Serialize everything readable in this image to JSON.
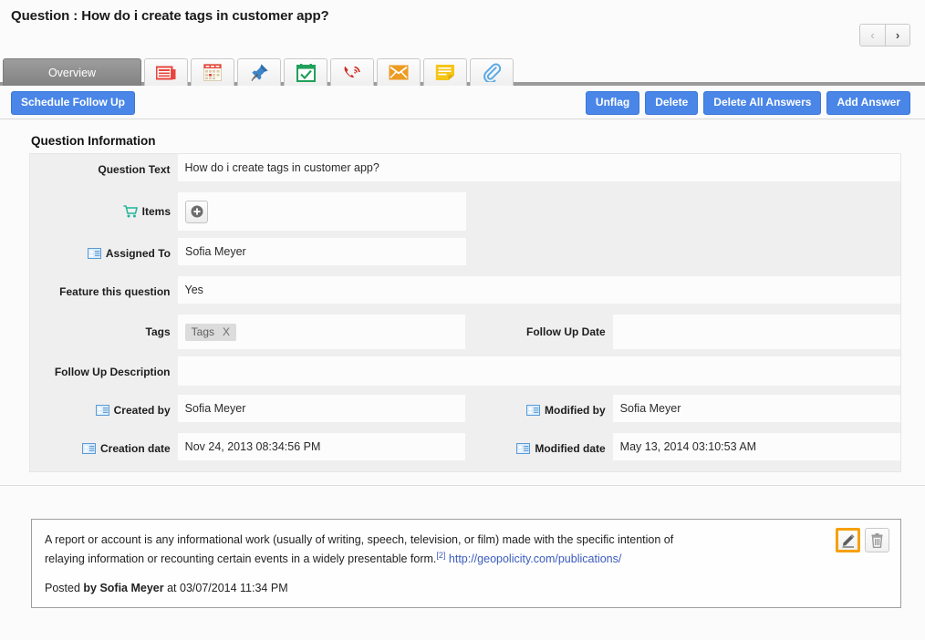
{
  "header": {
    "title": "Question : How do i create tags in customer app?",
    "pager": {
      "prev": "‹",
      "next": "›"
    }
  },
  "tabs": [
    {
      "label": "Overview",
      "icon": "overview",
      "active": true
    },
    {
      "label": "",
      "icon": "news-icon",
      "active": false
    },
    {
      "label": "",
      "icon": "calendar-icon",
      "active": false
    },
    {
      "label": "",
      "icon": "pushpin-icon",
      "active": false
    },
    {
      "label": "",
      "icon": "calendar-check-icon",
      "active": false
    },
    {
      "label": "",
      "icon": "phone-icon",
      "active": false
    },
    {
      "label": "",
      "icon": "envelope-icon",
      "active": false
    },
    {
      "label": "",
      "icon": "note-icon",
      "active": false
    },
    {
      "label": "",
      "icon": "paperclip-icon",
      "active": false
    }
  ],
  "actions": {
    "schedule_follow_up": "Schedule Follow Up",
    "unflag": "Unflag",
    "delete": "Delete",
    "delete_all_answers": "Delete All Answers",
    "add_answer": "Add Answer"
  },
  "section": {
    "title": "Question Information",
    "fields": {
      "question_text": {
        "label": "Question Text",
        "value": "How do i create tags in customer app?"
      },
      "items": {
        "label": "Items",
        "icon": "cart-icon",
        "add_button": "+"
      },
      "assigned_to": {
        "label": "Assigned To",
        "icon": "contact-card-icon",
        "value": "Sofia Meyer"
      },
      "feature_this_question": {
        "label": "Feature this question",
        "value": "Yes"
      },
      "tags": {
        "label": "Tags",
        "pill": "Tags",
        "pill_remove": "X"
      },
      "follow_up_date": {
        "label": "Follow Up Date",
        "value": ""
      },
      "follow_up_description": {
        "label": "Follow Up Description",
        "value": ""
      },
      "created_by": {
        "label": "Created by",
        "icon": "contact-card-icon",
        "value": "Sofia Meyer"
      },
      "modified_by": {
        "label": "Modified by",
        "icon": "contact-card-icon",
        "value": "Sofia Meyer"
      },
      "creation_date": {
        "label": "Creation date",
        "icon": "contact-card-icon",
        "value": "Nov 24, 2013 08:34:56 PM"
      },
      "modified_date": {
        "label": "Modified date",
        "icon": "contact-card-icon",
        "value": "May 13, 2014 03:10:53 AM"
      }
    }
  },
  "answer": {
    "text_part1": "A report or account is any informational work (usually of writing, speech, television, or film) made with the specific intention of relaying information or recounting certain events in a widely presentable form.",
    "citation": "[2]",
    "link": "http://geopolicity.com/publications/",
    "posted_prefix": "Posted ",
    "posted_author": "by Sofia Meyer",
    "posted_suffix": " at 03/07/2014 11:34 PM",
    "edit_icon": "pencil-icon",
    "delete_icon": "trash-icon"
  },
  "colors": {
    "accent_blue": "#4a86e8",
    "active_tab_gray": "#8d8d8d",
    "highlight_orange": "#f6a10b",
    "link_blue": "#3b5bbd"
  }
}
